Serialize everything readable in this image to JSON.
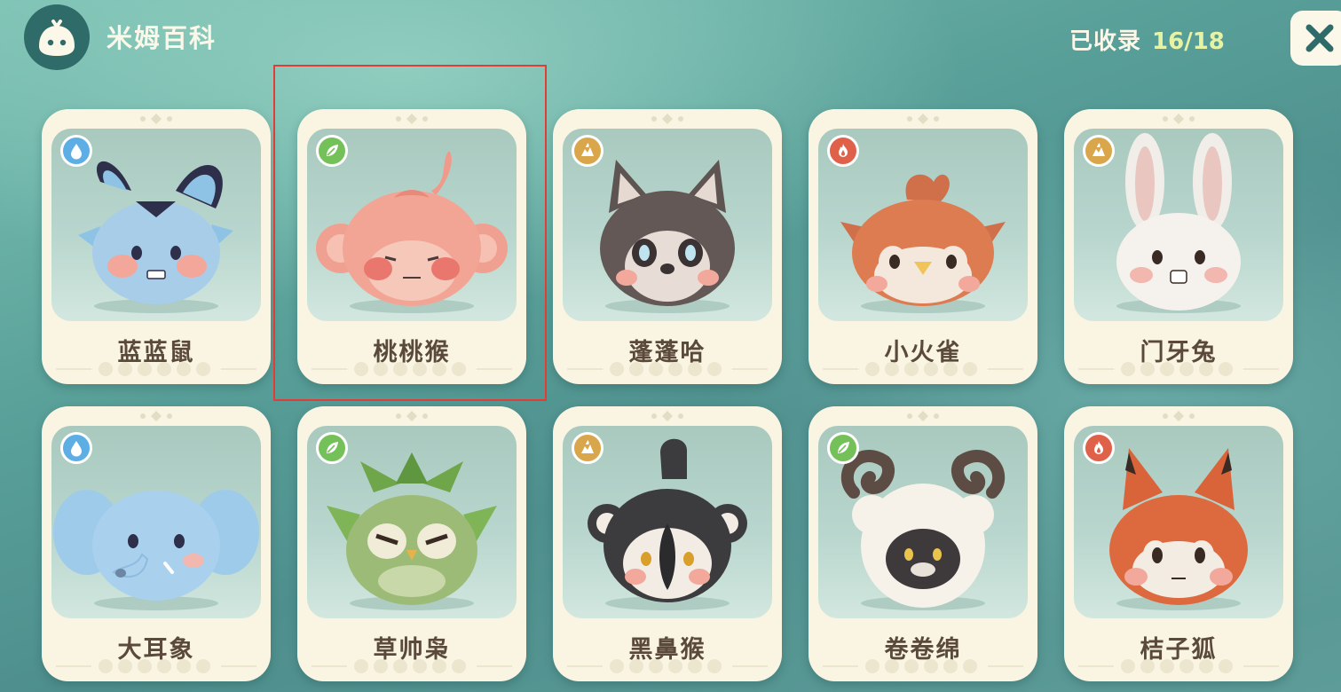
{
  "header": {
    "logo_icon": "slime-face-icon",
    "title": "米姆百科",
    "collected_label": "已收录",
    "collected_count": "16/18",
    "close_icon": "close-x-icon"
  },
  "colors": {
    "water": "#5eaee6",
    "grass": "#74c15a",
    "earth": "#d9a64b",
    "fire": "#e0614a",
    "selection": "#e33b35"
  },
  "cards": [
    {
      "name": "蓝蓝鼠",
      "element": "water",
      "element_icon": "water-drop-icon",
      "selected": false
    },
    {
      "name": "桃桃猴",
      "element": "grass",
      "element_icon": "leaf-icon",
      "selected": true
    },
    {
      "name": "蓬蓬哈",
      "element": "earth",
      "element_icon": "earth-flame-icon",
      "selected": false
    },
    {
      "name": "小火雀",
      "element": "fire",
      "element_icon": "fire-icon",
      "selected": false
    },
    {
      "name": "门牙兔",
      "element": "earth",
      "element_icon": "earth-flame-icon",
      "selected": false
    },
    {
      "name": "大耳象",
      "element": "water",
      "element_icon": "water-drop-icon",
      "selected": false
    },
    {
      "name": "草帅枭",
      "element": "grass",
      "element_icon": "leaf-icon",
      "selected": false
    },
    {
      "name": "黑鼻猴",
      "element": "earth",
      "element_icon": "earth-flame-icon",
      "selected": false
    },
    {
      "name": "卷卷绵",
      "element": "grass",
      "element_icon": "leaf-icon",
      "selected": false
    },
    {
      "name": "桔子狐",
      "element": "fire",
      "element_icon": "fire-icon",
      "selected": false
    }
  ]
}
